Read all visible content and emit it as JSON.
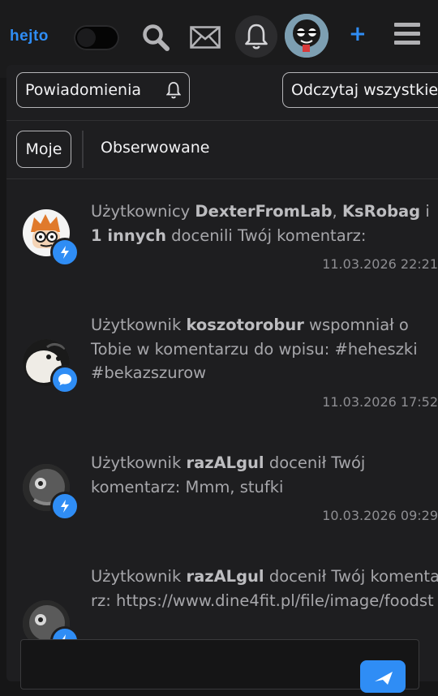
{
  "header": {
    "logo_text": "hejto",
    "icons": [
      "search-icon",
      "mail-icon",
      "bell-icon",
      "plus-icon",
      "menu-icon"
    ],
    "accent_color": "#2f8df5"
  },
  "panel": {
    "notifications_button_label": "Powiadomienia",
    "mark_all_read_label": "Odczytaj wszystkie",
    "tabs": [
      {
        "label": "Moje",
        "active": true
      },
      {
        "label": "Obserwowane",
        "active": false
      }
    ]
  },
  "notifications": [
    {
      "pre": "Użytkownicy ",
      "user1": "DexterFromLab",
      "sep1": ", ",
      "user2": "KsRobag",
      "sep2": " i ",
      "others": "1 innych",
      "post": " docenili Twój komentarz:",
      "time": "11.03.2026 22:21",
      "badge": "lightning-icon"
    },
    {
      "pre": "Użytkownik ",
      "user1": "koszotorobur",
      "post": " wspomniał o Tobie w komentarzu do wpisu: #heheszki #bekazszurow",
      "time": "11.03.2026 17:52",
      "badge": "comment-icon"
    },
    {
      "pre": "Użytkownik ",
      "user1": "razALgul",
      "post": " docenił Twój komentarz: Mmm, stufki",
      "time": "10.03.2026 09:29",
      "badge": "lightning-icon"
    },
    {
      "pre": "Użytkownik ",
      "user1": "razALgul",
      "post": " docenił Twój komentarz: https://www.dine4fit.pl/file/image/foodst",
      "badge": "lightning-icon"
    }
  ]
}
